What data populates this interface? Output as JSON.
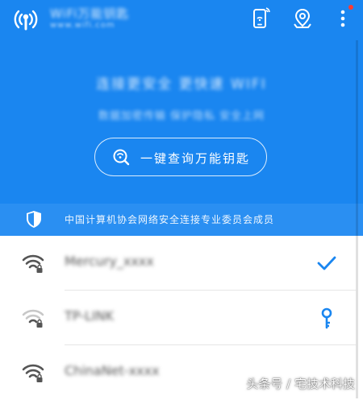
{
  "app": {
    "title": "WiFi万能钥匙",
    "subtitle": "www.wifi.com"
  },
  "topbar_icons": [
    "logo-icon",
    "phone-wifi-icon",
    "location-icon",
    "more-icon"
  ],
  "hero": {
    "line1": "连接更安全 更快速 WIFI",
    "line2": "数据加密传输 保护隐私 安全上网",
    "button_label": "一键查询万能钥匙"
  },
  "security": {
    "text": "中国计算机协会网络安全连接专业委员会成员"
  },
  "networks": [
    {
      "ssid": "Mercury_xxxx",
      "action_icon": "check-icon"
    },
    {
      "ssid": "TP-LINK",
      "action_icon": "key-icon"
    },
    {
      "ssid": "ChinaNet-xxxx",
      "action_icon": ""
    }
  ],
  "watermark": "头条号 / 宅技术科技",
  "colors": {
    "brand": "#1a86f0",
    "accent": "#1a86f0",
    "notification": "#ff3b30"
  }
}
